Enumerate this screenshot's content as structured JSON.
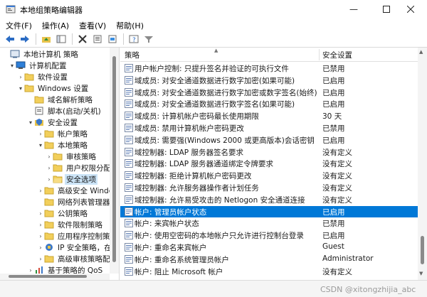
{
  "window": {
    "title": "本地组策略编辑器",
    "icon": "group-policy-icon"
  },
  "menu": [
    "文件(F)",
    "操作(A)",
    "查看(V)",
    "帮助(H)"
  ],
  "toolbar": [
    "back-arrow-icon",
    "forward-arrow-icon",
    "up-folder-icon",
    "show-tree-icon",
    "delete-icon",
    "properties-icon",
    "export-list-icon",
    "help-icon",
    "filter-icon"
  ],
  "tree": [
    {
      "label": "本地计算机 策略",
      "arrow": "",
      "icon": "computer-policy-icon"
    },
    {
      "label": "计算机配置",
      "arrow": "⌄",
      "icon": "computer-icon"
    },
    {
      "label": "软件设置",
      "arrow": "›",
      "icon": "folder-icon"
    },
    {
      "label": "Windows 设置",
      "arrow": "⌄",
      "icon": "folder-icon"
    },
    {
      "label": "域名解析策略",
      "arrow": "",
      "icon": "folder-icon"
    },
    {
      "label": "脚本(启动/关机)",
      "arrow": "",
      "icon": "script-icon"
    },
    {
      "label": "安全设置",
      "arrow": "⌄",
      "icon": "security-icon"
    },
    {
      "label": "帐户策略",
      "arrow": "›",
      "icon": "folder-icon"
    },
    {
      "label": "本地策略",
      "arrow": "⌄",
      "icon": "folder-icon"
    },
    {
      "label": "审核策略",
      "arrow": "›",
      "icon": "folder-icon"
    },
    {
      "label": "用户权限分配",
      "arrow": "›",
      "icon": "folder-icon"
    },
    {
      "label": "安全选项",
      "arrow": "›",
      "icon": "folder-open-icon",
      "selected": true
    },
    {
      "label": "高级安全 Windc",
      "arrow": "›",
      "icon": "folder-icon"
    },
    {
      "label": "网络列表管理器",
      "arrow": "",
      "icon": "folder-icon"
    },
    {
      "label": "公钥策略",
      "arrow": "›",
      "icon": "folder-icon"
    },
    {
      "label": "软件限制策略",
      "arrow": "›",
      "icon": "folder-icon"
    },
    {
      "label": "应用程序控制策",
      "arrow": "›",
      "icon": "folder-icon"
    },
    {
      "label": "IP 安全策略，在",
      "arrow": "›",
      "icon": "ip-security-icon"
    },
    {
      "label": "高级审核策略配",
      "arrow": "›",
      "icon": "folder-icon"
    },
    {
      "label": "基于策略的 QoS",
      "arrow": "›",
      "icon": "qos-chart-icon"
    }
  ],
  "list": {
    "col_policy": "策略",
    "col_setting": "安全设置",
    "rows": [
      {
        "name": "用户帐户控制: 只提升签名并验证的可执行文件",
        "value": "已禁用"
      },
      {
        "name": "域成员: 对安全通道数据进行数字加密(如果可能)",
        "value": "已启用"
      },
      {
        "name": "域成员: 对安全通道数据进行数字加密或数字签名(始终)",
        "value": "已启用"
      },
      {
        "name": "域成员: 对安全通道数据进行数字签名(如果可能)",
        "value": "已启用"
      },
      {
        "name": "域成员: 计算机帐户密码最长使用期限",
        "value": "30 天"
      },
      {
        "name": "域成员: 禁用计算机帐户密码更改",
        "value": "已禁用"
      },
      {
        "name": "域成员: 需要强(Windows 2000 或更高版本)会话密钥",
        "value": "已启用"
      },
      {
        "name": "域控制器: LDAP 服务器签名要求",
        "value": "没有定义"
      },
      {
        "name": "域控制器: LDAP 服务器通道绑定令牌要求",
        "value": "没有定义"
      },
      {
        "name": "域控制器: 拒绝计算机帐户密码更改",
        "value": "没有定义"
      },
      {
        "name": "域控制器: 允许服务器操作者计划任务",
        "value": "没有定义"
      },
      {
        "name": "域控制器: 允许易受攻击的 Netlogon 安全通道连接",
        "value": "没有定义"
      },
      {
        "name": "帐户: 管理员帐户状态",
        "value": "已启用",
        "selected": true
      },
      {
        "name": "帐户: 来宾帐户状态",
        "value": "已禁用"
      },
      {
        "name": "帐户: 使用空密码的本地帐户只允许进行控制台登录",
        "value": "已启用"
      },
      {
        "name": "帐户: 重命名来宾帐户",
        "value": "Guest"
      },
      {
        "name": "帐户: 重命名系统管理员帐户",
        "value": "Administrator"
      },
      {
        "name": "帐户: 阻止 Microsoft 帐户",
        "value": "没有定义"
      }
    ]
  },
  "watermark": "CSDN @xitongzhijia_abc"
}
